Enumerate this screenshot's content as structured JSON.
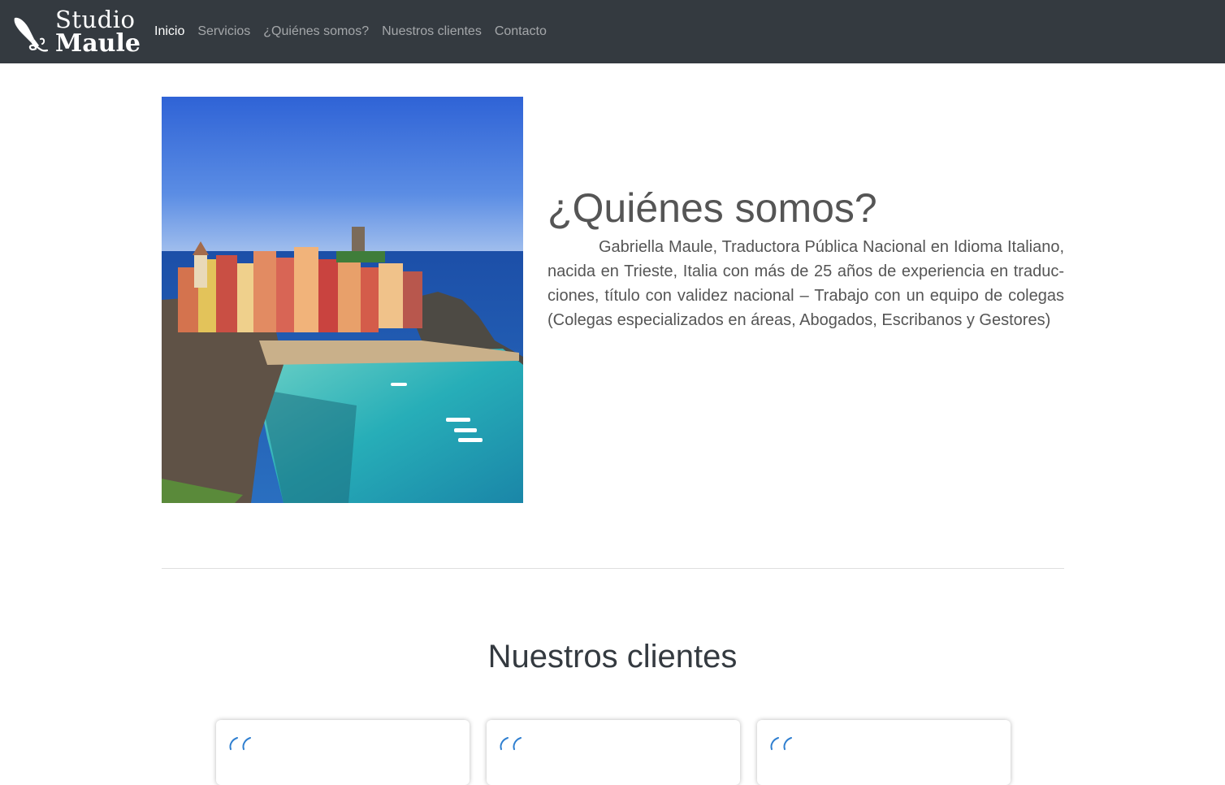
{
  "brand": {
    "line1": "Studio",
    "line2": "Maule",
    "logo_icon": "fountain-pen-icon"
  },
  "nav": {
    "items": [
      {
        "label": "Inicio",
        "active": true
      },
      {
        "label": "Servicios",
        "active": false
      },
      {
        "label": "¿Quiénes somos?",
        "active": false
      },
      {
        "label": "Nuestros clientes",
        "active": false
      },
      {
        "label": "Contacto",
        "active": false
      }
    ]
  },
  "about": {
    "title": "¿Quiénes somos?",
    "text": "Gabriella Maule, Traductora Pública Nacional en Idioma Italiano, nacida en Trieste, Italia con más de 25 años de experiencia en traduc­ciones, título con validez nacional – Trabajo con un equipo de colegas (Colegas especializados en áreas, Abogados, Escribanos y Gestores)",
    "image": "coastal-village-photo"
  },
  "clients": {
    "title": "Nuestros clientes",
    "cards": [
      {
        "icon": "quote-icon"
      },
      {
        "icon": "quote-icon"
      },
      {
        "icon": "quote-icon"
      }
    ]
  },
  "colors": {
    "navbar": "#343a40",
    "text": "#555555",
    "accent": "#2f7fd0"
  }
}
